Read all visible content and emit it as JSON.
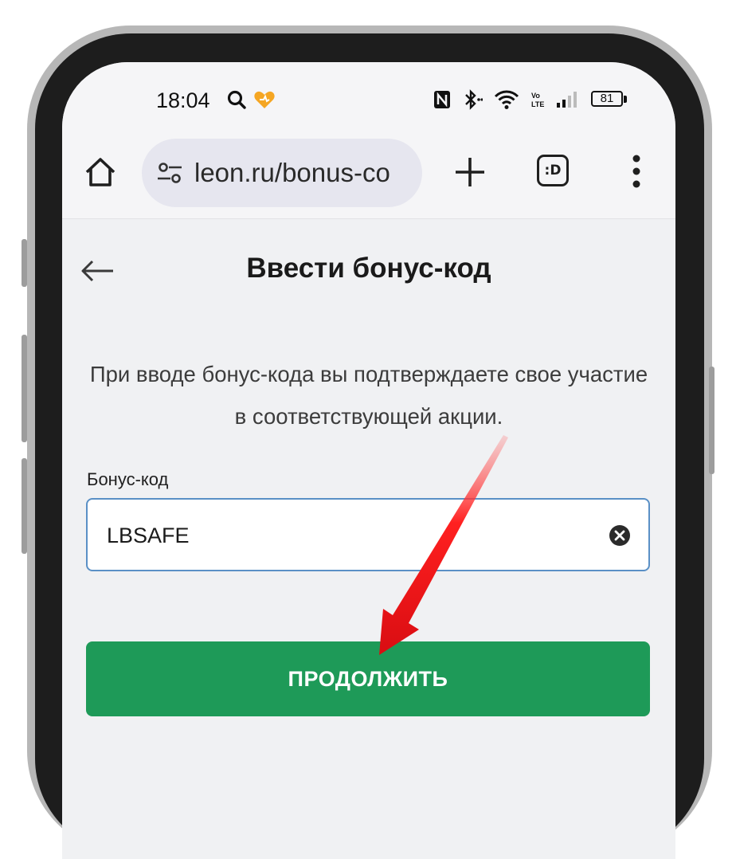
{
  "statusbar": {
    "time": "18:04",
    "battery": "81",
    "icons": [
      "search-icon",
      "heart-icon",
      "nfc-icon",
      "bluetooth-icon",
      "wifi-icon",
      "volte-icon",
      "signal-icon",
      "battery-icon"
    ]
  },
  "browser": {
    "url": "leon.ru/bonus-co",
    "tabs_label": ":D",
    "icons": [
      "home-icon",
      "site-settings-icon",
      "plus-icon",
      "tabs-icon",
      "more-vert-icon"
    ]
  },
  "page": {
    "title": "Ввести бонус-код",
    "description": "При вводе бонус-кода вы подтверждаете свое участие в соответствующей акции.",
    "field_label": "Бонус-код",
    "field_value": "LBSAFE",
    "continue_label": "ПРОДОЛЖИТЬ"
  },
  "colors": {
    "accent_green": "#1e9a58",
    "input_border": "#5a90c6",
    "annotation_red": "#e8161b",
    "phone_frame": "#1d1d1d"
  }
}
